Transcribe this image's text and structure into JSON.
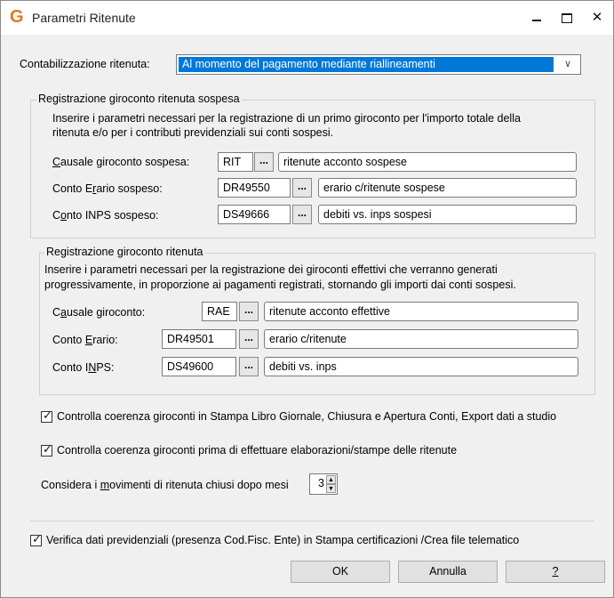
{
  "window": {
    "title": "Parametri Ritenute",
    "min_label": "_",
    "close_label": "✕"
  },
  "contabilizzazione": {
    "label": "Contabilizzazione ritenuta:",
    "value": "Al momento del pagamento mediante riallineamenti"
  },
  "sospesa": {
    "legend": "Registrazione giroconto ritenuta sospesa",
    "desc_line1": "Inserire i parametri necessari per la registrazione di un primo giroconto per l'importo totale della",
    "desc_line2": "ritenuta e/o per i contributi previdenziali sui conti sospesi.",
    "causale": {
      "label_a": "C",
      "label_b": "ausale giroconto sospesa:",
      "code": "RIT",
      "desc": "ritenute acconto sospese"
    },
    "erario": {
      "label_a": "Conto E",
      "label_b": "r",
      "label_c": "ario sospeso:",
      "code": "DR49550",
      "desc": "erario c/ritenute sospese"
    },
    "inps": {
      "label_a": "C",
      "label_b": "o",
      "label_c": "nto INPS sospeso:",
      "code": "DS49666",
      "desc": "debiti vs. inps sospesi"
    }
  },
  "effettiva": {
    "legend": "Registrazione giroconto ritenuta",
    "desc_line1": "Inserire i parametri necessari per la registrazione dei giroconti effettivi che verranno generati",
    "desc_line2": "progressivamente, in proporzione ai pagamenti registrati, stornando gli importi dai conti sospesi.",
    "causale": {
      "label_a": "C",
      "label_b": "a",
      "label_c": "usale giroconto:",
      "code": "RAE",
      "desc": "ritenute acconto effettive"
    },
    "erario": {
      "label_a": "Conto ",
      "label_b": "E",
      "label_c": "rario:",
      "code": "DR49501",
      "desc": "erario c/ritenute"
    },
    "inps": {
      "label_a": "Conto I",
      "label_b": "N",
      "label_c": "PS:",
      "code": "DS49600",
      "desc": "debiti vs. inps"
    }
  },
  "options": {
    "chk1": {
      "label": "Controlla coerenza giroconti in Stampa Libro Giornale, Chiusura e Apertura Conti, Export dati a studio",
      "checked": true
    },
    "chk2": {
      "label": "Controlla coerenza giroconti prima di effettuare elaborazioni/stampe delle ritenute",
      "checked": true
    },
    "mesi": {
      "label_a": "Considera i ",
      "label_b": "m",
      "label_c": "ovimenti di ritenuta chiusi dopo mesi",
      "value": "3"
    },
    "chk3": {
      "label": "Verifica dati previdenziali (presenza Cod.Fisc. Ente) in Stampa certificazioni /Crea file telematico",
      "checked": true
    }
  },
  "buttons": {
    "ok": "OK",
    "annulla": "Annulla",
    "help": "?"
  },
  "ellipsis": "..."
}
